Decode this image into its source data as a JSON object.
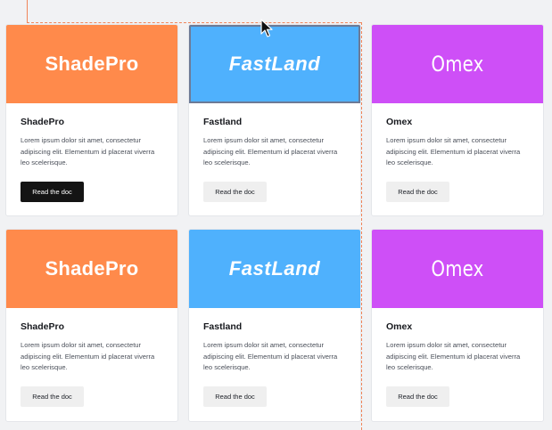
{
  "colors": {
    "shadepro": "#ff8a4b",
    "fastland": "#4fb1fd",
    "omex": "#ce4ff7",
    "button_dark": "#141414",
    "button_light": "#efefef",
    "guide": "#f0855a"
  },
  "cards": [
    {
      "logo": "ShadePro",
      "title": "ShadePro",
      "description": "Lorem ipsum dolor sit amet, consectetur adipiscing elit. Elementum id placerat viverra leo scelerisque.",
      "button": "Read the doc"
    },
    {
      "logo": "FastLand",
      "title": "Fastland",
      "description": "Lorem ipsum dolor sit amet, consectetur adipiscing elit. Elementum id placerat viverra leo scelerisque.",
      "button": "Read the doc"
    },
    {
      "logo": "Omex",
      "title": "Omex",
      "description": "Lorem ipsum dolor sit amet, consectetur adipiscing elit. Elementum id placerat viverra leo scelerisque.",
      "button": "Read the doc"
    },
    {
      "logo": "ShadePro",
      "title": "ShadePro",
      "description": "Lorem ipsum dolor sit amet, consectetur adipiscing elit. Elementum id placerat viverra leo scelerisque.",
      "button": "Read the doc"
    },
    {
      "logo": "FastLand",
      "title": "Fastland",
      "description": "Lorem ipsum dolor sit amet, consectetur adipiscing elit. Elementum id placerat viverra leo scelerisque.",
      "button": "Read the doc"
    },
    {
      "logo": "Omex",
      "title": "Omex",
      "description": "Lorem ipsum dolor sit amet, consectetur adipiscing elit. Elementum id placerat viverra leo scelerisque.",
      "button": "Read the doc"
    }
  ],
  "cursor_icon": "mouse-pointer-icon"
}
